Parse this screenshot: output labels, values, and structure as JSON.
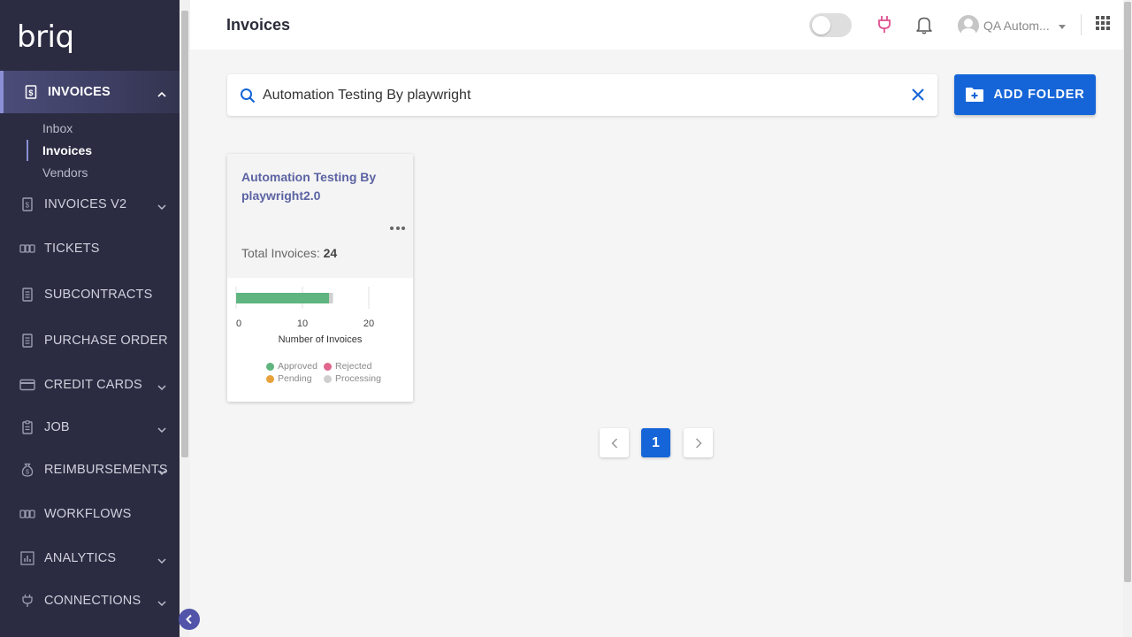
{
  "app": {
    "logo": "briq"
  },
  "sidebar": {
    "sections": [
      {
        "label": "INVOICES",
        "icon": "invoice-icon",
        "expanded": true,
        "subitems": [
          {
            "label": "Inbox"
          },
          {
            "label": "Invoices",
            "active": true
          },
          {
            "label": "Vendors"
          }
        ]
      },
      {
        "label": "INVOICES V2",
        "icon": "invoice-icon",
        "has_chevron": true
      },
      {
        "label": "TICKETS",
        "icon": "ticket-icon"
      },
      {
        "label": "SUBCONTRACTS",
        "icon": "document-icon"
      },
      {
        "label": "PURCHASE ORDER",
        "icon": "document-icon"
      },
      {
        "label": "CREDIT CARDS",
        "icon": "credit-card-icon",
        "has_chevron": true
      },
      {
        "label": "JOB",
        "icon": "clipboard-icon",
        "has_chevron": true
      },
      {
        "label": "REIMBURSEMENTS",
        "icon": "money-bag-icon",
        "has_chevron": true
      },
      {
        "label": "WORKFLOWS",
        "icon": "workflow-icon"
      },
      {
        "label": "ANALYTICS",
        "icon": "bar-chart-icon",
        "has_chevron": true
      },
      {
        "label": "CONNECTIONS",
        "icon": "plug-icon",
        "has_chevron": true
      }
    ]
  },
  "header": {
    "title": "Invoices",
    "toggle_on": false,
    "user_name": "QA Autom..."
  },
  "search": {
    "value": "Automation Testing By playwright",
    "placeholder": "Search"
  },
  "add_folder": {
    "label": "ADD FOLDER"
  },
  "folders": [
    {
      "title": "Automation Testing By playwright2.0",
      "total_label": "Total Invoices: ",
      "total_value": "24"
    }
  ],
  "chart_data": {
    "type": "bar",
    "orientation": "horizontal",
    "stacked": true,
    "categories": [
      ""
    ],
    "series": [
      {
        "name": "Approved",
        "values": [
          14
        ]
      },
      {
        "name": "Rejected",
        "values": [
          0
        ]
      },
      {
        "name": "Pending",
        "values": [
          0
        ]
      },
      {
        "name": "Processing",
        "values": [
          0.6
        ]
      }
    ],
    "xlabel": "Number of Invoices",
    "xlim": [
      0,
      20
    ],
    "xticks": [
      "0",
      "10",
      "20"
    ],
    "grid": true,
    "legend_position": "bottom",
    "colors": {
      "Approved": "#5fb47f",
      "Rejected": "#e0668c",
      "Pending": "#e8a23c",
      "Processing": "#cfcfcf"
    }
  },
  "pagination": {
    "current_page": "1"
  },
  "colors": {
    "sidebar_bg": "#2b2c42",
    "primary": "#1565d8",
    "accent_link": "#5b63a3",
    "plug_icon": "#e0508f"
  }
}
